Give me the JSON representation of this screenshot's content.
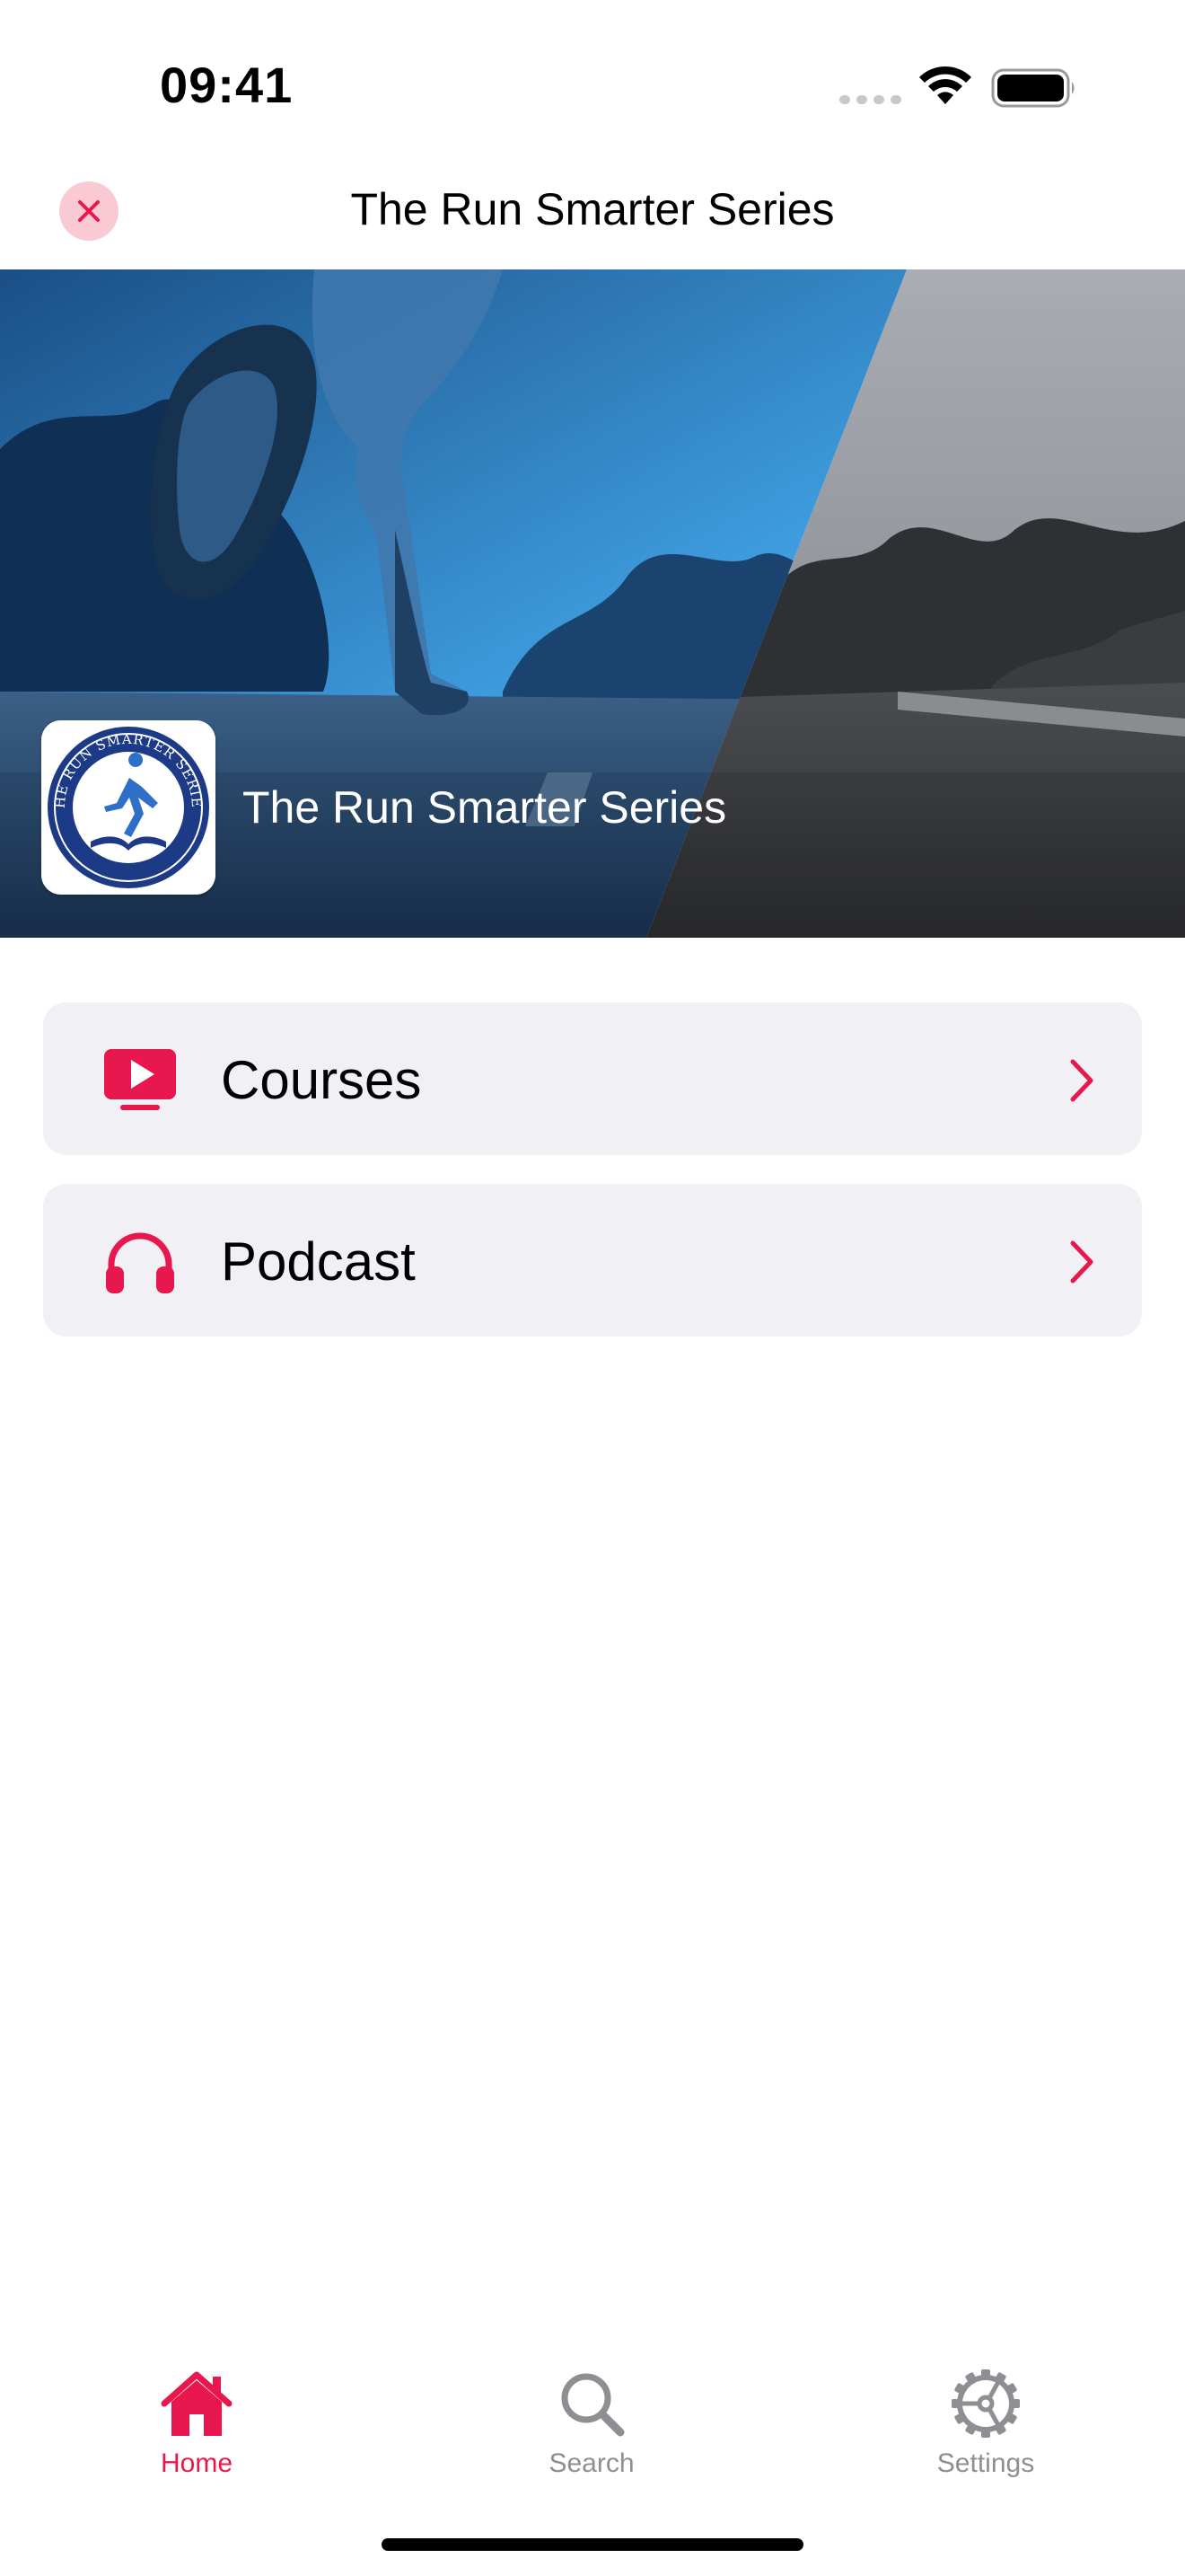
{
  "status_bar": {
    "time": "09:41"
  },
  "nav": {
    "title": "The Run Smarter Series",
    "close_icon": "close-icon"
  },
  "hero": {
    "title": "The Run Smarter Series",
    "logo_text": "THE RUN SMARTER SERIES"
  },
  "menu": {
    "items": [
      {
        "label": "Courses",
        "icon": "tv-play-icon"
      },
      {
        "label": "Podcast",
        "icon": "headphones-icon"
      }
    ]
  },
  "tab_bar": {
    "tabs": [
      {
        "label": "Home",
        "icon": "house-icon",
        "selected": true
      },
      {
        "label": "Search",
        "icon": "magnifying-glass-icon",
        "selected": false
      },
      {
        "label": "Settings",
        "icon": "gear-icon",
        "selected": false
      }
    ]
  },
  "colors": {
    "accent": "#e8174d",
    "card_background": "#f1f0f5",
    "inactive_tab": "#8e8e93",
    "close_button_bg": "#f9c9d4"
  }
}
